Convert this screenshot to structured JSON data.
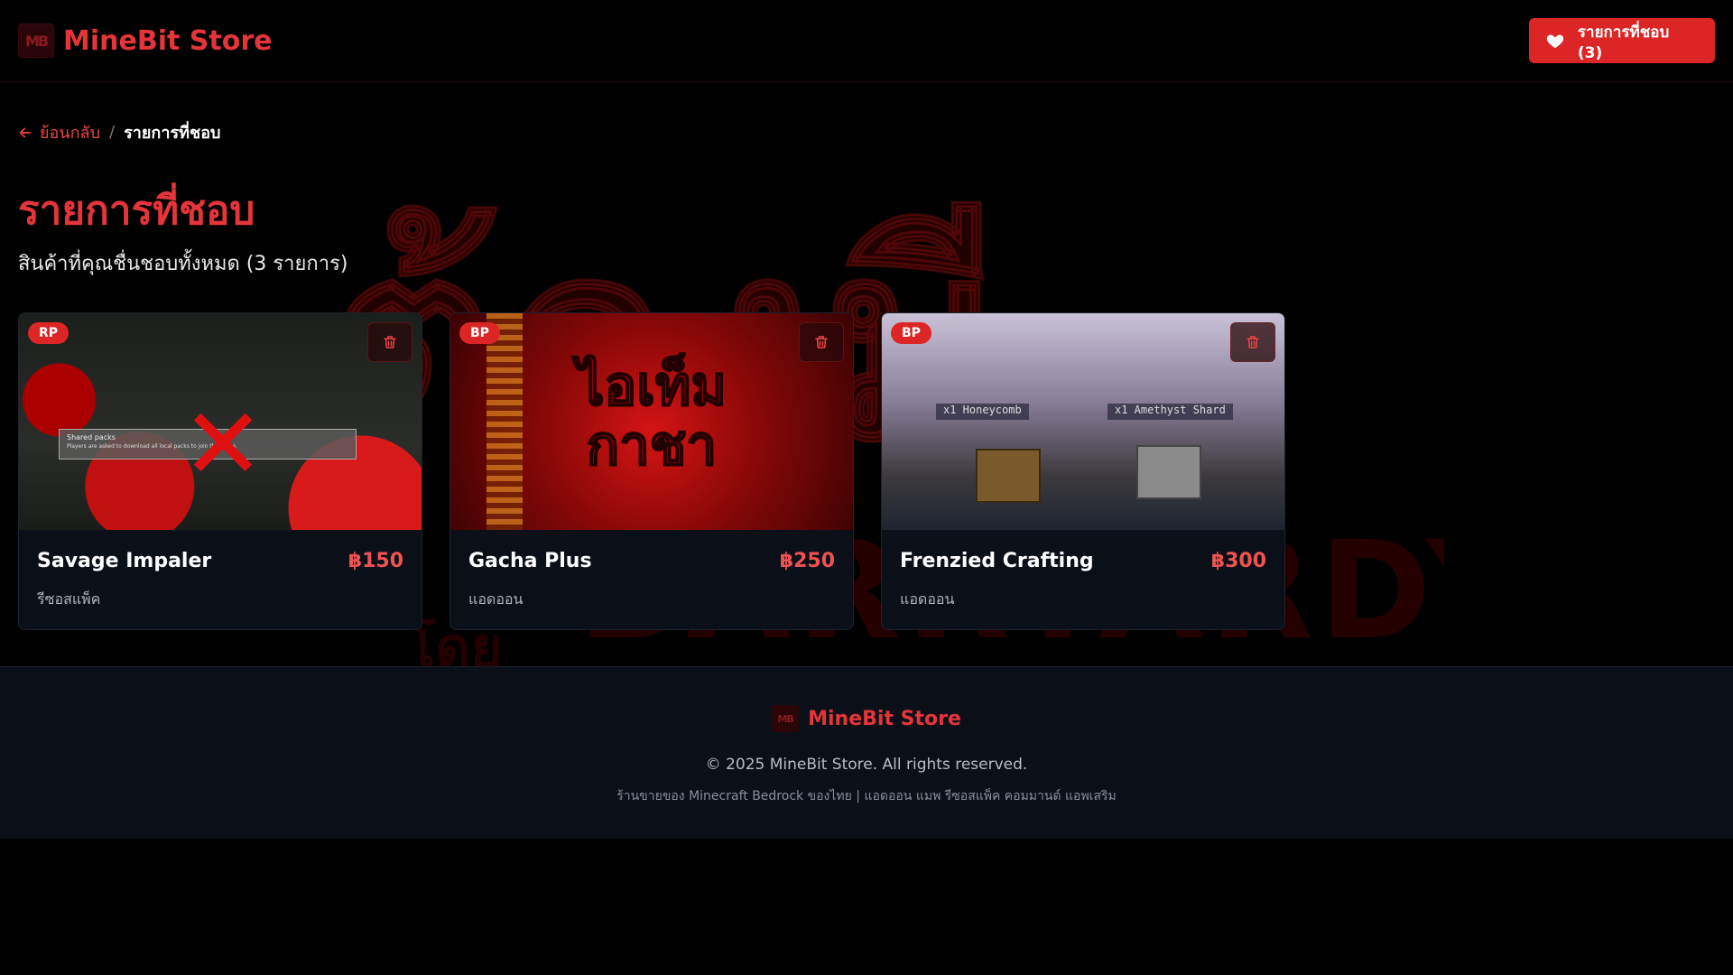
{
  "header": {
    "logo_text": "MB",
    "brand_name": "MineBit Store",
    "wishlist_button": "รายการที่ชอบ (3)"
  },
  "breadcrumb": {
    "back": "ย้อนกลับ",
    "separator": "/",
    "current": "รายการที่ชอบ"
  },
  "page": {
    "title": "รายการที่ชอบ",
    "subtitle": "สินค้าที่คุณชื่นชอบทั้งหมด (3 รายการ)"
  },
  "cards": [
    {
      "badge": "RP",
      "name": "Savage Impaler",
      "price": "฿150",
      "category": "รีซอสแพ็ค",
      "image_panel_title": "Shared packs",
      "image_panel_text": "Players are asked to download all local packs to join the game."
    },
    {
      "badge": "BP",
      "name": "Gacha Plus",
      "price": "฿250",
      "category": "แอดออน",
      "image_text_line1": "ไอเท็ม",
      "image_text_line2": "กาชา"
    },
    {
      "badge": "BP",
      "name": "Frenzied Crafting",
      "price": "฿300",
      "category": "แอดออน",
      "image_tag1": "x1 Honeycomb",
      "image_tag2": "x1 Amethyst Shard"
    }
  ],
  "background_art": {
    "line1": "ต้องมี",
    "line2": "BARRYARDY",
    "line3": "โดย"
  },
  "footer": {
    "logo_text": "MB",
    "brand_name": "MineBit Store",
    "copyright": "© 2025 MineBit Store. All rights reserved.",
    "tagline": "ร้านขายของ Minecraft Bedrock ของไทย | แอดออน แมพ รีซอสแพ็ค คอมมานด์ แอพเสริม"
  },
  "colors": {
    "accent": "#dc2626",
    "brand": "#e5343a",
    "price": "#f05252"
  },
  "icons": {
    "wishlist": "heart-icon",
    "back": "arrow-left-icon",
    "delete": "trash-icon"
  }
}
